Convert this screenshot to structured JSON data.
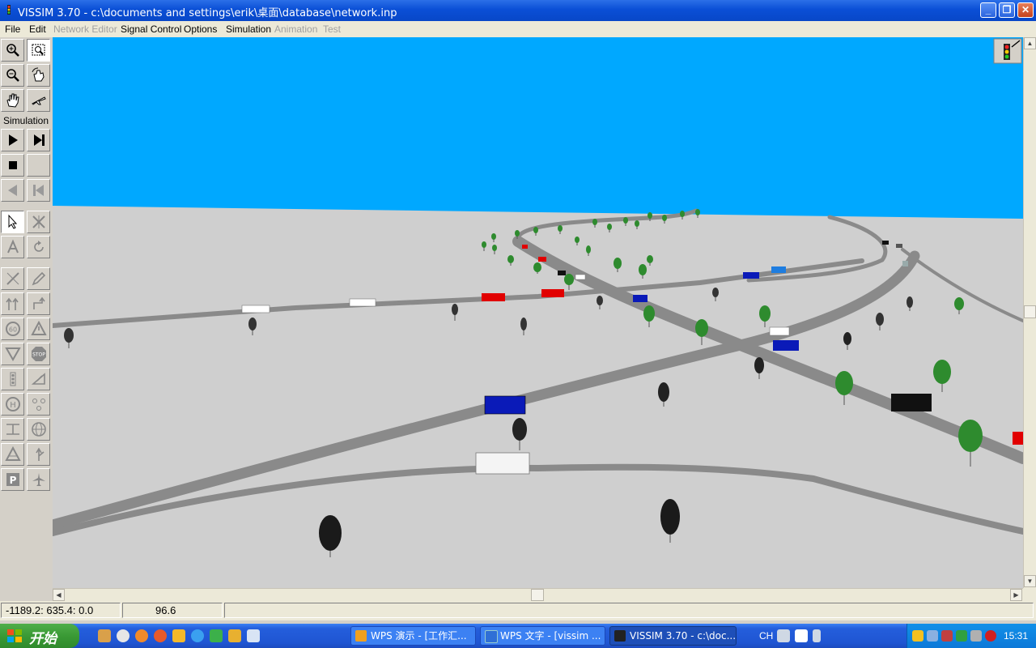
{
  "window": {
    "title": "VISSIM 3.70 - c:\\documents and settings\\erik\\桌面\\database\\network.inp"
  },
  "menu": {
    "items": [
      {
        "label": "File",
        "enabled": true
      },
      {
        "label": "Edit",
        "enabled": true
      },
      {
        "label": "Network Editor",
        "enabled": false
      },
      {
        "label": "Signal Control",
        "enabled": true
      },
      {
        "label": "Options",
        "enabled": true
      },
      {
        "label": "Simulation",
        "enabled": true
      },
      {
        "label": "Animation",
        "enabled": false
      },
      {
        "label": "Test",
        "enabled": false
      }
    ]
  },
  "toolbar": {
    "simulation_label": "Simulation"
  },
  "status": {
    "coordinates": "-1189.2: 635.4: 0.0",
    "value": "96.6"
  },
  "taskbar": {
    "start_label": "开始",
    "tasks": [
      {
        "label": "WPS 演示 - [工作汇...",
        "active": false
      },
      {
        "label": "WPS 文字 - [vissim ...",
        "active": false
      },
      {
        "label": "VISSIM 3.70 - c:\\doc...",
        "active": true
      }
    ],
    "language": "CH",
    "clock": "15:31"
  },
  "colors": {
    "sky": "#00a8ff",
    "ground": "#cfcfcf",
    "road": "#8a8a8a",
    "titlebar": "#0a4fd6",
    "taskbar": "#245edc"
  }
}
